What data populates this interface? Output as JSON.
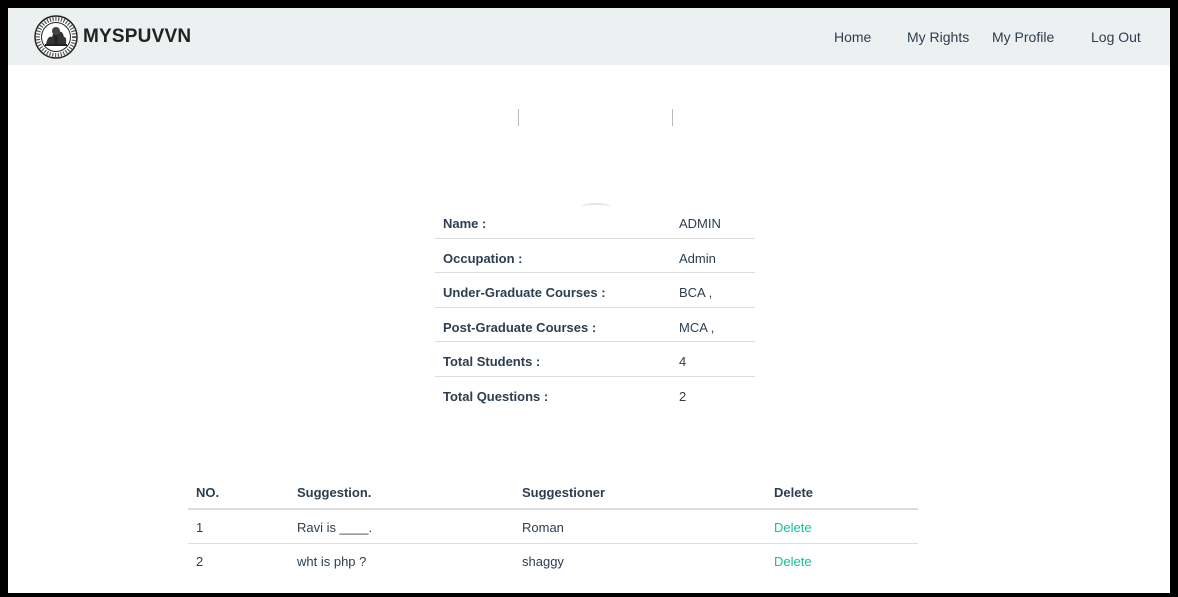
{
  "nav": {
    "brand": "MYSPUVVN",
    "items": [
      "Home",
      "My Rights",
      "My Profile",
      "Log Out"
    ]
  },
  "profile": {
    "rows": [
      {
        "label": "Name :",
        "value": "ADMIN"
      },
      {
        "label": "Occupation :",
        "value": "Admin"
      },
      {
        "label": "Under-Graduate Courses :",
        "value": "BCA ,"
      },
      {
        "label": "Post-Graduate Courses :",
        "value": "MCA ,"
      },
      {
        "label": "Total Students :",
        "value": "4"
      },
      {
        "label": "Total Questions :",
        "value": "2"
      }
    ]
  },
  "suggestions": {
    "headers": [
      "NO.",
      "Suggestion.",
      "Suggestioner",
      "Delete"
    ],
    "rows": [
      {
        "no": "1",
        "suggestion": "Ravi is ____.",
        "suggestioner": "Roman",
        "action": "Delete"
      },
      {
        "no": "2",
        "suggestion": "wht is php ?",
        "suggestioner": "shaggy",
        "action": "Delete"
      }
    ]
  },
  "colors": {
    "navbar_bg": "#ecf0f1",
    "text": "#2c3e50",
    "link": "#18bc9c"
  },
  "icons": {
    "logo": "university-seal-logo"
  }
}
